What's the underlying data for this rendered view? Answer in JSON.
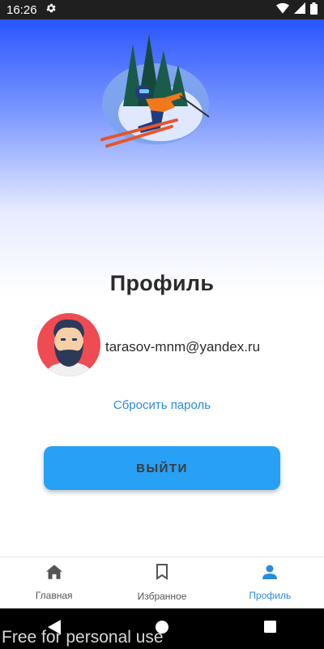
{
  "status_bar": {
    "time": "16:26"
  },
  "profile": {
    "title": "Профиль",
    "email": "tarasov-mnm@yandex.ru",
    "reset_password": "Сбросить пароль",
    "logout_label": "ВЫЙТИ"
  },
  "bottom_nav": {
    "items": [
      {
        "label": "Главная",
        "icon": "home-icon",
        "active": false
      },
      {
        "label": "Избранное",
        "icon": "bookmark-icon",
        "active": false
      },
      {
        "label": "Профиль",
        "icon": "person-icon",
        "active": true
      }
    ]
  },
  "watermark": "Free for personal use",
  "colors": {
    "accent": "#27a0f5",
    "link": "#2a8bdc",
    "hero_top": "#2a55ff"
  }
}
